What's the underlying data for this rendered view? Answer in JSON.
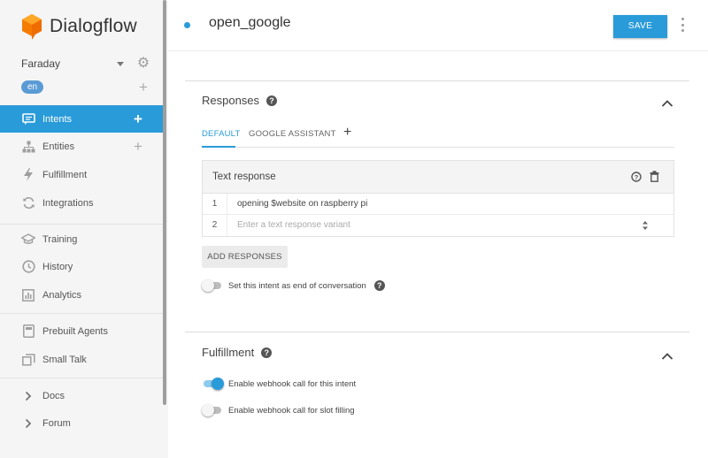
{
  "app": {
    "name": "Dialogflow",
    "brand_color": "#f57c00",
    "accent_color": "#2a9bd9"
  },
  "sidebar": {
    "agent_name": "Faraday",
    "language": "en",
    "items": [
      {
        "label": "Intents",
        "icon": "chat-icon",
        "active": true,
        "has_add": true
      },
      {
        "label": "Entities",
        "icon": "entities-icon",
        "active": false,
        "has_add": true
      },
      {
        "label": "Fulfillment",
        "icon": "bolt-icon",
        "active": false,
        "has_add": false
      },
      {
        "label": "Integrations",
        "icon": "sync-icon",
        "active": false,
        "has_add": false
      },
      {
        "label": "Training",
        "icon": "mortarboard-icon",
        "active": false,
        "has_add": false
      },
      {
        "label": "History",
        "icon": "clock-icon",
        "active": false,
        "has_add": false
      },
      {
        "label": "Analytics",
        "icon": "bar-chart-icon",
        "active": false,
        "has_add": false
      },
      {
        "label": "Prebuilt Agents",
        "icon": "agent-book-icon",
        "active": false,
        "has_add": false
      },
      {
        "label": "Small Talk",
        "icon": "small-talk-icon",
        "active": false,
        "has_add": false
      },
      {
        "label": "Docs",
        "icon": "chevron-right-icon",
        "active": false,
        "has_add": false
      },
      {
        "label": "Forum",
        "icon": "chevron-right-icon",
        "active": false,
        "has_add": false
      }
    ]
  },
  "header": {
    "intent_name": "open_google",
    "save_label": "SAVE"
  },
  "responses": {
    "title": "Responses",
    "tabs": [
      "DEFAULT",
      "GOOGLE ASSISTANT"
    ],
    "active_tab": "DEFAULT",
    "text_response": {
      "title": "Text response",
      "rows": [
        {
          "num": "1",
          "text": "opening $website on raspberry pi"
        },
        {
          "num": "2",
          "placeholder": "Enter a text response variant"
        }
      ]
    },
    "add_button": "ADD RESPONSES",
    "end_conversation": {
      "label": "Set this intent as end of conversation",
      "enabled": false
    }
  },
  "fulfillment": {
    "title": "Fulfillment",
    "webhook": {
      "label": "Enable webhook call for this intent",
      "enabled": true
    },
    "slot_filling": {
      "label": "Enable webhook call for slot filling",
      "enabled": false
    }
  }
}
